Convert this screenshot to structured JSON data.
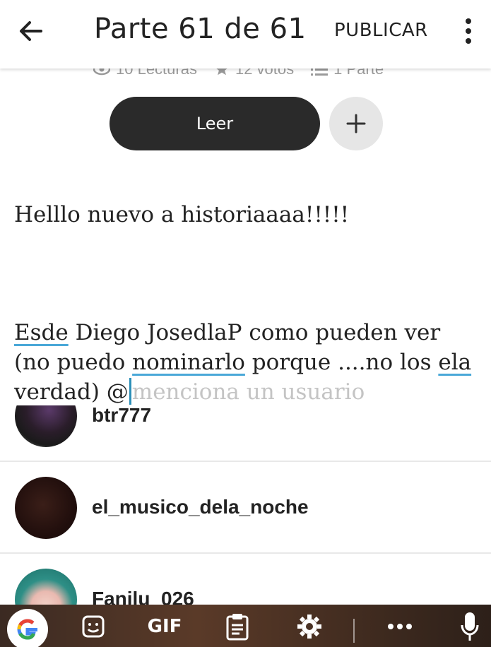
{
  "appbar": {
    "title": "Parte 61 de 61",
    "publish_label": "PUBLICAR"
  },
  "story": {
    "reads": "10 Lecturas",
    "votes": "12 votos",
    "parts": "1 Parte",
    "read_button": "Leer"
  },
  "editor": {
    "line1": "Helllo nuevo a historiaaaa!!!!!",
    "p2_w1": "Esde",
    "p2_w2": " Diego JosedlaP como pueden ver (no puedo ",
    "p2_w3": "nominarlo",
    "p2_w4": " porque ....no los ",
    "p2_w5": "ela",
    "p2_w6": " verdad) @",
    "placeholder": "menciona un usuario"
  },
  "mentions": [
    {
      "username": "btr777"
    },
    {
      "username": "el_musico_dela_noche"
    },
    {
      "username": "Fanilu_026"
    }
  ],
  "keyboard": {
    "gif_label": "GIF",
    "icons": [
      "google-icon",
      "sticker-icon",
      "clipboard-icon",
      "gear-icon",
      "more-icon",
      "mic-icon"
    ]
  },
  "colors": {
    "accent_underline": "#4aa8d8",
    "cursor": "#2c8fb8",
    "read_button": "#2a2a2a"
  }
}
